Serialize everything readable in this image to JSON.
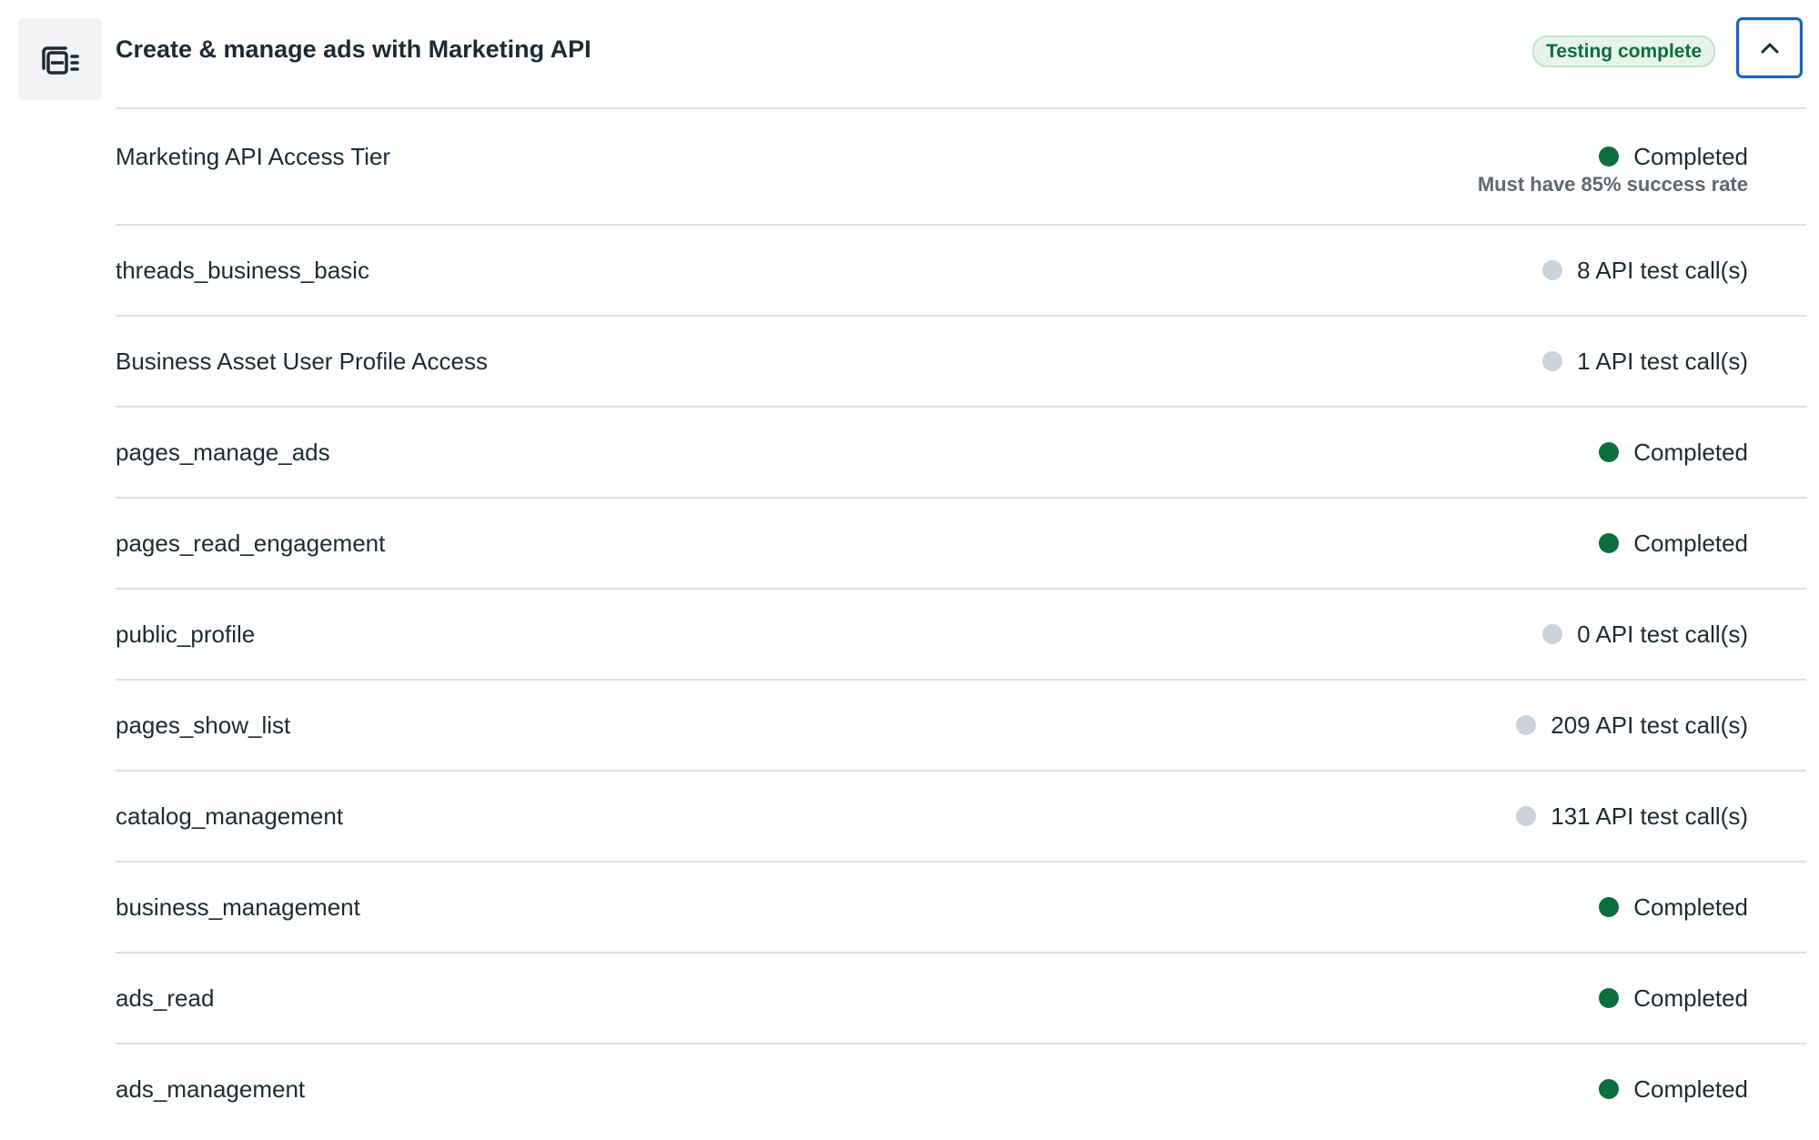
{
  "header": {
    "title": "Create & manage ads with Marketing API",
    "badge": "Testing complete",
    "icon": "ads-stack-icon",
    "collapse_icon": "chevron-up-icon"
  },
  "colors": {
    "completed": "#0b6e3f",
    "pending": "#cbd2d9",
    "focus": "#1664c7"
  },
  "rows": [
    {
      "label": "Marketing API Access Tier",
      "status": "Completed",
      "state": "done",
      "note": "Must have 85% success rate"
    },
    {
      "label": "threads_business_basic",
      "status": "8 API test call(s)",
      "state": "pending"
    },
    {
      "label": "Business Asset User Profile Access",
      "status": "1 API test call(s)",
      "state": "pending"
    },
    {
      "label": "pages_manage_ads",
      "status": "Completed",
      "state": "done"
    },
    {
      "label": "pages_read_engagement",
      "status": "Completed",
      "state": "done"
    },
    {
      "label": "public_profile",
      "status": "0 API test call(s)",
      "state": "pending"
    },
    {
      "label": "pages_show_list",
      "status": "209 API test call(s)",
      "state": "pending"
    },
    {
      "label": "catalog_management",
      "status": "131 API test call(s)",
      "state": "pending"
    },
    {
      "label": "business_management",
      "status": "Completed",
      "state": "done"
    },
    {
      "label": "ads_read",
      "status": "Completed",
      "state": "done"
    },
    {
      "label": "ads_management",
      "status": "Completed",
      "state": "done"
    }
  ]
}
